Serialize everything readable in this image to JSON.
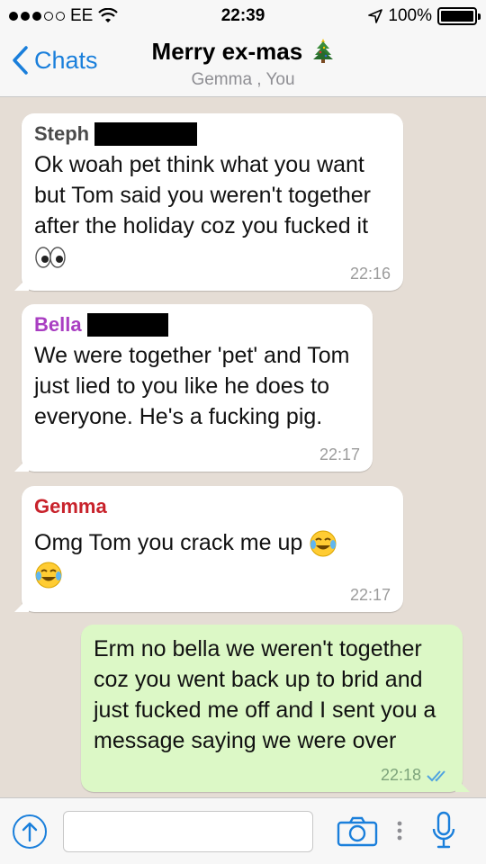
{
  "status_bar": {
    "carrier": "EE",
    "time": "22:39",
    "battery": "100%"
  },
  "header": {
    "back_label": "Chats",
    "title": "Merry ex-mas",
    "title_icon": "christmas-tree-icon",
    "subtitle": "Gemma , You"
  },
  "messages": [
    {
      "sender": "Steph",
      "sender_color": "#4a4a4a",
      "text": "Ok woah pet think what you want but Tom said you weren't together after the holiday coz you fucked it",
      "emoji": "eyes-icon",
      "time": "22:16"
    },
    {
      "sender": "Bella",
      "sender_color": "#a93ec2",
      "text": "We were together 'pet' and Tom just lied to you like he does to everyone. He's a fucking pig.",
      "time": "22:17"
    },
    {
      "sender": "Gemma",
      "sender_color": "#c8222b",
      "text": "Omg Tom you crack me up",
      "emoji": "tears-of-joy-icon",
      "time": "22:17"
    },
    {
      "sender": "You",
      "text": "Erm no bella we weren't together coz you went back up to brid and just fucked me off and I sent you a message saying we were over",
      "time": "22:18",
      "status_icon": "double-check-icon"
    }
  ],
  "colors": {
    "accent": "#1a7fdb",
    "outgoing_bubble": "#dcf8c6",
    "incoming_bubble": "#ffffff",
    "chat_background": "#e5ddd5"
  },
  "input": {
    "placeholder": ""
  }
}
